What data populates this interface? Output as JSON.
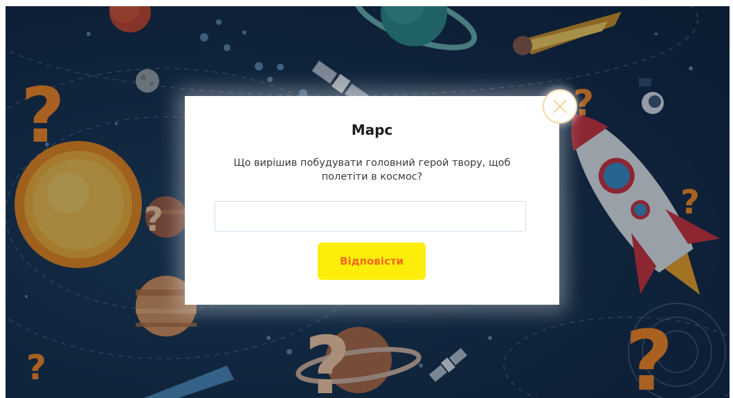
{
  "dialog": {
    "title": "Марс",
    "question": "Що вирішив побудувати головний герой твору, щоб полетіти в космос?",
    "answer_value": "",
    "answer_placeholder": "",
    "submit_label": "Відповісти"
  },
  "icons": {
    "close": "close-icon"
  },
  "colors": {
    "background": "#15304b",
    "button_bg": "#fcee0a",
    "button_text": "#f06a1e",
    "question_mark": "#ff8a1f"
  }
}
